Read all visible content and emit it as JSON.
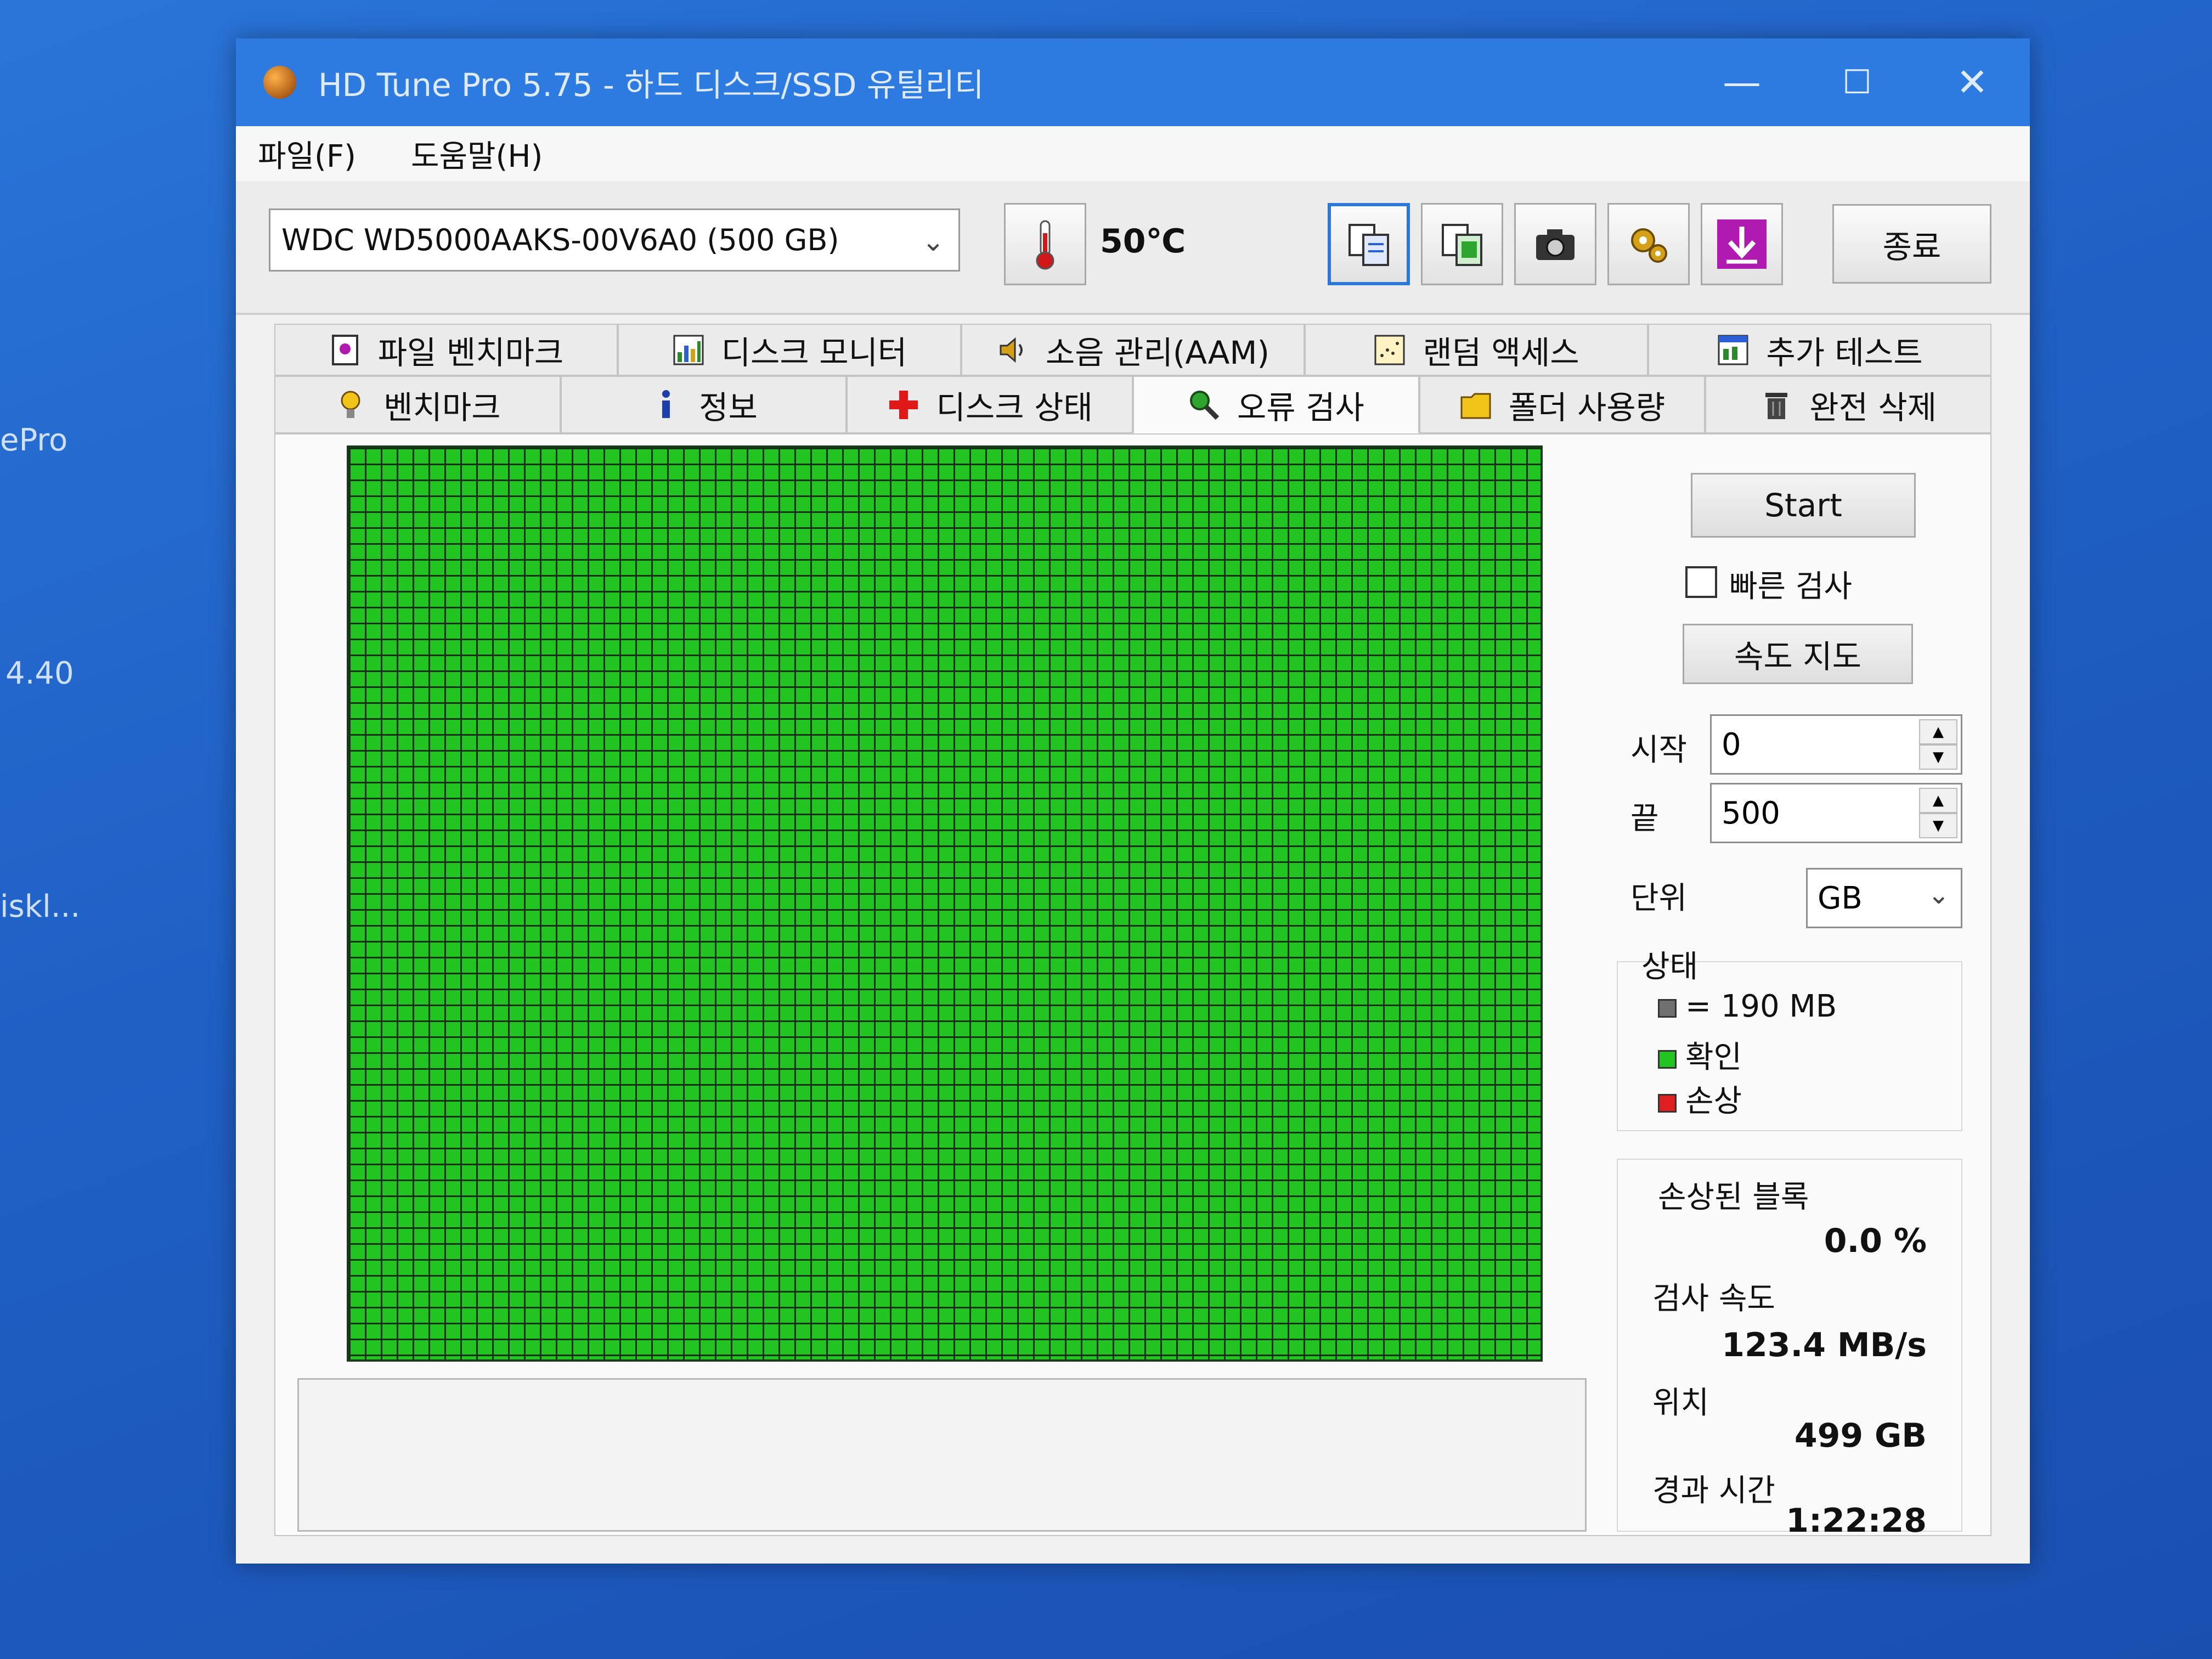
{
  "desktop": {
    "labels": [
      "ePro",
      "4.40",
      "iskl..."
    ]
  },
  "window": {
    "title": "HD Tune Pro 5.75 - 하드 디스크/SSD 유틸리티",
    "controls": {
      "minimize": "—",
      "maximize": "☐",
      "close": "✕"
    }
  },
  "menu": {
    "file": "파일(F)",
    "help": "도움말(H)"
  },
  "toolbar": {
    "drive": "WDC WD5000AAKS-00V6A0 (500 GB)",
    "temperature": "50℃",
    "exit_label": "종료"
  },
  "tabs": {
    "row1": [
      {
        "label": "파일 벤치마크",
        "icon": "file-benchmark-icon"
      },
      {
        "label": "디스크 모니터",
        "icon": "disk-monitor-icon"
      },
      {
        "label": "소음 관리(AAM)",
        "icon": "speaker-icon"
      },
      {
        "label": "랜덤 액세스",
        "icon": "random-access-icon"
      },
      {
        "label": "추가 테스트",
        "icon": "extra-tests-icon"
      }
    ],
    "row2": [
      {
        "label": "벤치마크",
        "icon": "lightbulb-icon"
      },
      {
        "label": "정보",
        "icon": "info-icon"
      },
      {
        "label": "디스크 상태",
        "icon": "health-cross-icon"
      },
      {
        "label": "오류 검사",
        "icon": "magnifier-icon"
      },
      {
        "label": "폴더 사용량",
        "icon": "folder-icon"
      },
      {
        "label": "완전 삭제",
        "icon": "trash-icon"
      }
    ],
    "active": "오류 검사"
  },
  "error_scan": {
    "start_label": "Start",
    "quick_scan_label": "빠른 검사",
    "quick_scan_checked": false,
    "speed_map_label": "속도 지도",
    "start_field_label": "시작",
    "start_value": "0",
    "end_field_label": "끝",
    "end_value": "500",
    "unit_label": "단위",
    "unit_value": "GB",
    "status": {
      "title": "상태",
      "block_size": "= 190 MB",
      "ok": "확인",
      "damaged": "손상"
    },
    "stats": {
      "damaged_blocks_label": "손상된 블록",
      "damaged_blocks_value": "0.0 %",
      "scan_speed_label": "검사 속도",
      "scan_speed_value": "123.4 MB/s",
      "position_label": "위치",
      "position_value": "499 GB",
      "elapsed_label": "경과 시간",
      "elapsed_value": "1:22:28"
    },
    "colors": {
      "ok": "#22c422",
      "damaged": "#e02020",
      "block": "#707070"
    }
  }
}
